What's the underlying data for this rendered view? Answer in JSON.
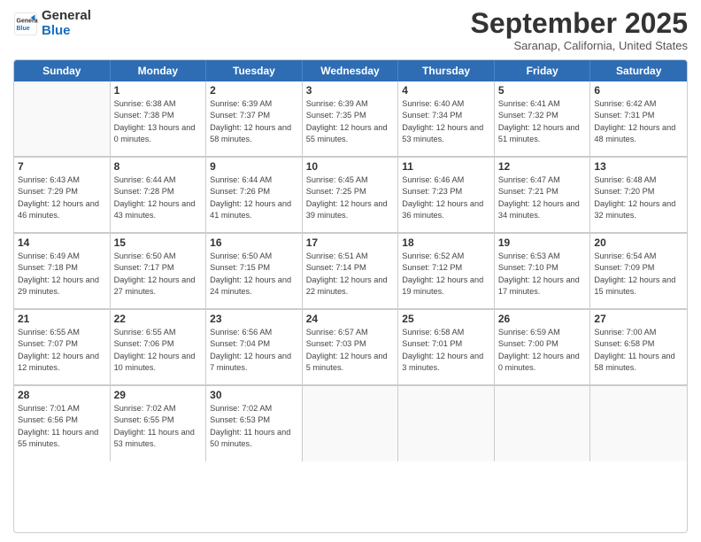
{
  "logo": {
    "general": "General",
    "blue": "Blue"
  },
  "title": "September 2025",
  "location": "Saranap, California, United States",
  "weekdays": [
    "Sunday",
    "Monday",
    "Tuesday",
    "Wednesday",
    "Thursday",
    "Friday",
    "Saturday"
  ],
  "weeks": [
    [
      {
        "day": "",
        "sunrise": "",
        "sunset": "",
        "daylight": "",
        "empty": true
      },
      {
        "day": "1",
        "sunrise": "Sunrise: 6:38 AM",
        "sunset": "Sunset: 7:38 PM",
        "daylight": "Daylight: 13 hours and 0 minutes."
      },
      {
        "day": "2",
        "sunrise": "Sunrise: 6:39 AM",
        "sunset": "Sunset: 7:37 PM",
        "daylight": "Daylight: 12 hours and 58 minutes."
      },
      {
        "day": "3",
        "sunrise": "Sunrise: 6:39 AM",
        "sunset": "Sunset: 7:35 PM",
        "daylight": "Daylight: 12 hours and 55 minutes."
      },
      {
        "day": "4",
        "sunrise": "Sunrise: 6:40 AM",
        "sunset": "Sunset: 7:34 PM",
        "daylight": "Daylight: 12 hours and 53 minutes."
      },
      {
        "day": "5",
        "sunrise": "Sunrise: 6:41 AM",
        "sunset": "Sunset: 7:32 PM",
        "daylight": "Daylight: 12 hours and 51 minutes."
      },
      {
        "day": "6",
        "sunrise": "Sunrise: 6:42 AM",
        "sunset": "Sunset: 7:31 PM",
        "daylight": "Daylight: 12 hours and 48 minutes."
      }
    ],
    [
      {
        "day": "7",
        "sunrise": "Sunrise: 6:43 AM",
        "sunset": "Sunset: 7:29 PM",
        "daylight": "Daylight: 12 hours and 46 minutes."
      },
      {
        "day": "8",
        "sunrise": "Sunrise: 6:44 AM",
        "sunset": "Sunset: 7:28 PM",
        "daylight": "Daylight: 12 hours and 43 minutes."
      },
      {
        "day": "9",
        "sunrise": "Sunrise: 6:44 AM",
        "sunset": "Sunset: 7:26 PM",
        "daylight": "Daylight: 12 hours and 41 minutes."
      },
      {
        "day": "10",
        "sunrise": "Sunrise: 6:45 AM",
        "sunset": "Sunset: 7:25 PM",
        "daylight": "Daylight: 12 hours and 39 minutes."
      },
      {
        "day": "11",
        "sunrise": "Sunrise: 6:46 AM",
        "sunset": "Sunset: 7:23 PM",
        "daylight": "Daylight: 12 hours and 36 minutes."
      },
      {
        "day": "12",
        "sunrise": "Sunrise: 6:47 AM",
        "sunset": "Sunset: 7:21 PM",
        "daylight": "Daylight: 12 hours and 34 minutes."
      },
      {
        "day": "13",
        "sunrise": "Sunrise: 6:48 AM",
        "sunset": "Sunset: 7:20 PM",
        "daylight": "Daylight: 12 hours and 32 minutes."
      }
    ],
    [
      {
        "day": "14",
        "sunrise": "Sunrise: 6:49 AM",
        "sunset": "Sunset: 7:18 PM",
        "daylight": "Daylight: 12 hours and 29 minutes."
      },
      {
        "day": "15",
        "sunrise": "Sunrise: 6:50 AM",
        "sunset": "Sunset: 7:17 PM",
        "daylight": "Daylight: 12 hours and 27 minutes."
      },
      {
        "day": "16",
        "sunrise": "Sunrise: 6:50 AM",
        "sunset": "Sunset: 7:15 PM",
        "daylight": "Daylight: 12 hours and 24 minutes."
      },
      {
        "day": "17",
        "sunrise": "Sunrise: 6:51 AM",
        "sunset": "Sunset: 7:14 PM",
        "daylight": "Daylight: 12 hours and 22 minutes."
      },
      {
        "day": "18",
        "sunrise": "Sunrise: 6:52 AM",
        "sunset": "Sunset: 7:12 PM",
        "daylight": "Daylight: 12 hours and 19 minutes."
      },
      {
        "day": "19",
        "sunrise": "Sunrise: 6:53 AM",
        "sunset": "Sunset: 7:10 PM",
        "daylight": "Daylight: 12 hours and 17 minutes."
      },
      {
        "day": "20",
        "sunrise": "Sunrise: 6:54 AM",
        "sunset": "Sunset: 7:09 PM",
        "daylight": "Daylight: 12 hours and 15 minutes."
      }
    ],
    [
      {
        "day": "21",
        "sunrise": "Sunrise: 6:55 AM",
        "sunset": "Sunset: 7:07 PM",
        "daylight": "Daylight: 12 hours and 12 minutes."
      },
      {
        "day": "22",
        "sunrise": "Sunrise: 6:55 AM",
        "sunset": "Sunset: 7:06 PM",
        "daylight": "Daylight: 12 hours and 10 minutes."
      },
      {
        "day": "23",
        "sunrise": "Sunrise: 6:56 AM",
        "sunset": "Sunset: 7:04 PM",
        "daylight": "Daylight: 12 hours and 7 minutes."
      },
      {
        "day": "24",
        "sunrise": "Sunrise: 6:57 AM",
        "sunset": "Sunset: 7:03 PM",
        "daylight": "Daylight: 12 hours and 5 minutes."
      },
      {
        "day": "25",
        "sunrise": "Sunrise: 6:58 AM",
        "sunset": "Sunset: 7:01 PM",
        "daylight": "Daylight: 12 hours and 3 minutes."
      },
      {
        "day": "26",
        "sunrise": "Sunrise: 6:59 AM",
        "sunset": "Sunset: 7:00 PM",
        "daylight": "Daylight: 12 hours and 0 minutes."
      },
      {
        "day": "27",
        "sunrise": "Sunrise: 7:00 AM",
        "sunset": "Sunset: 6:58 PM",
        "daylight": "Daylight: 11 hours and 58 minutes."
      }
    ],
    [
      {
        "day": "28",
        "sunrise": "Sunrise: 7:01 AM",
        "sunset": "Sunset: 6:56 PM",
        "daylight": "Daylight: 11 hours and 55 minutes."
      },
      {
        "day": "29",
        "sunrise": "Sunrise: 7:02 AM",
        "sunset": "Sunset: 6:55 PM",
        "daylight": "Daylight: 11 hours and 53 minutes."
      },
      {
        "day": "30",
        "sunrise": "Sunrise: 7:02 AM",
        "sunset": "Sunset: 6:53 PM",
        "daylight": "Daylight: 11 hours and 50 minutes."
      },
      {
        "day": "",
        "sunrise": "",
        "sunset": "",
        "daylight": "",
        "empty": true
      },
      {
        "day": "",
        "sunrise": "",
        "sunset": "",
        "daylight": "",
        "empty": true
      },
      {
        "day": "",
        "sunrise": "",
        "sunset": "",
        "daylight": "",
        "empty": true
      },
      {
        "day": "",
        "sunrise": "",
        "sunset": "",
        "daylight": "",
        "empty": true
      }
    ]
  ]
}
